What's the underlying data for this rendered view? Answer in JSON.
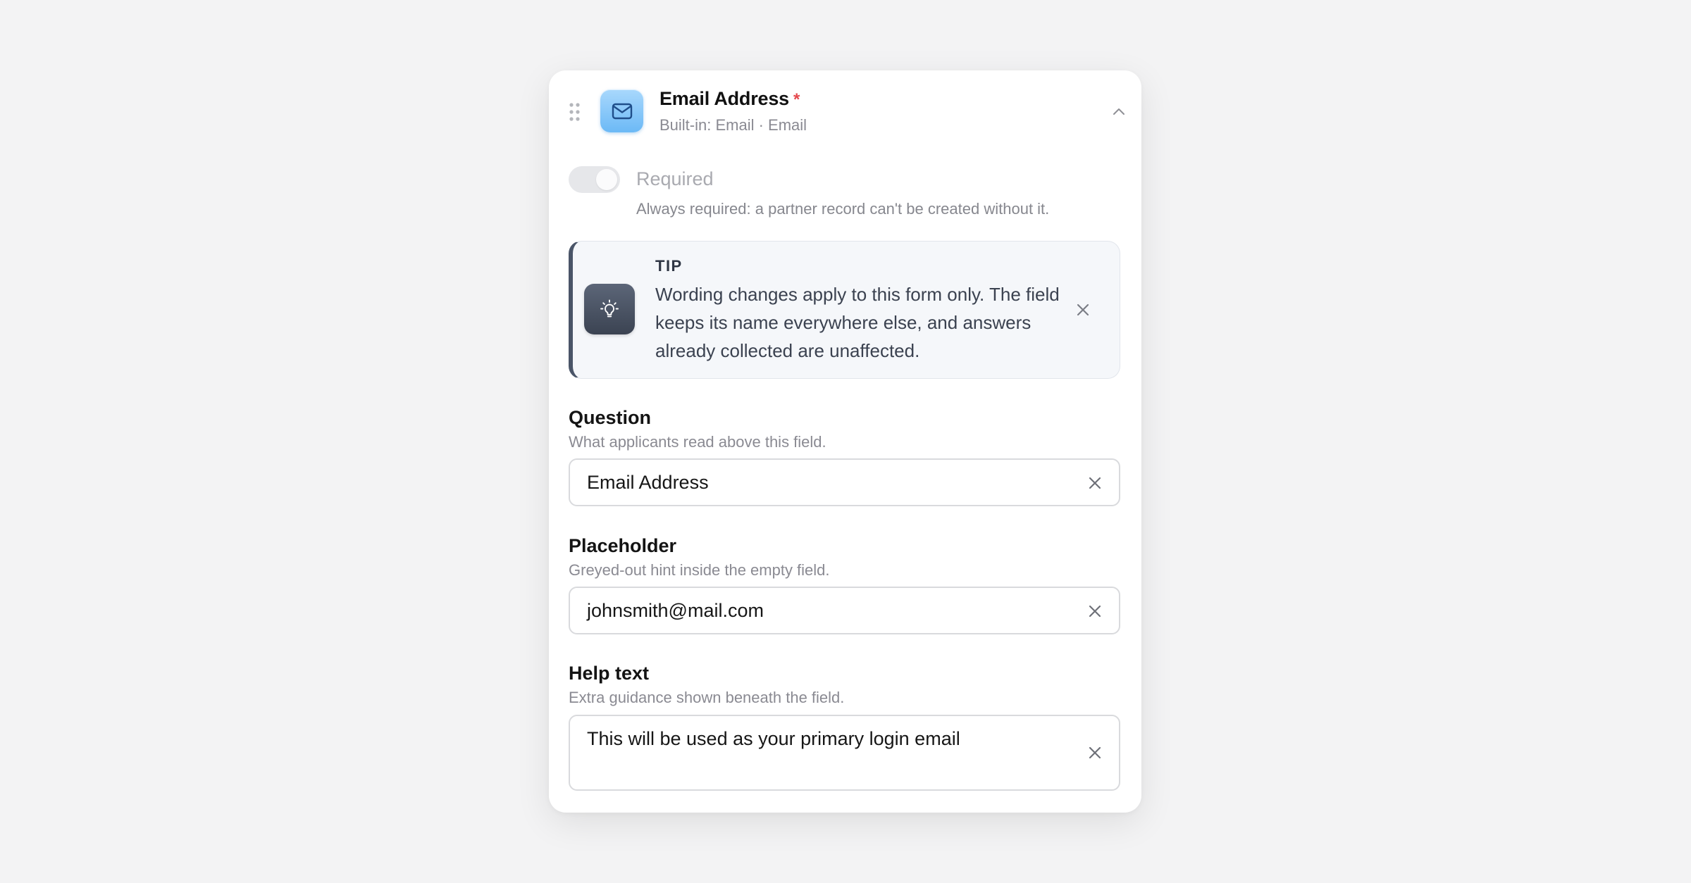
{
  "field": {
    "title": "Email Address",
    "required_marker": "*",
    "subtitle": "Built-in: Email · Email",
    "icon": "mail-icon",
    "accent": "#6cb9f6"
  },
  "required_toggle": {
    "label": "Required",
    "state": "on (disabled)",
    "help": "Always required: a partner record can't be created without it."
  },
  "tip": {
    "heading": "TIP",
    "body": "Wording changes apply to this form only. The field keeps its name everywhere else, and answers already collected are unaffected.",
    "icon": "lightbulb-icon",
    "accent": "#4a5568"
  },
  "question": {
    "label": "Question",
    "help": "What applicants read above this field.",
    "value": "Email Address"
  },
  "placeholder": {
    "label": "Placeholder",
    "help": "Greyed-out hint inside the empty field.",
    "value": "johnsmith@mail.com"
  },
  "help_text": {
    "label": "Help text",
    "help": "Extra guidance shown beneath the field.",
    "value": "This will be used as your primary login email"
  }
}
